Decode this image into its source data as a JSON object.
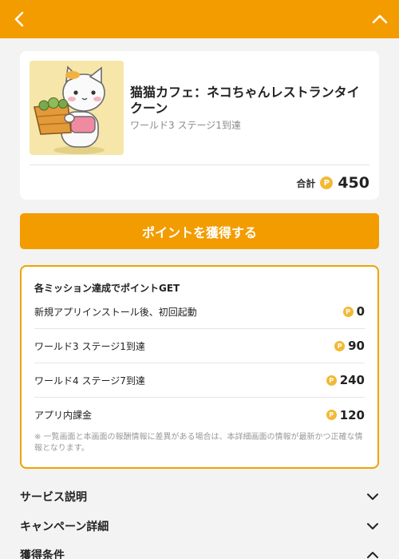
{
  "header": {
    "back_icon": "chevron-left-icon",
    "collapse_icon": "chevron-up-icon",
    "bg_color": "#f39c00"
  },
  "app": {
    "thumbnail_icon": "cat-holding-basket-illustration",
    "title": "猫猫カフェ：ネコちゃんレストランタイクーン",
    "subtitle": "ワールド3 ステージ1到達",
    "total_label": "合計",
    "coin_symbol": "P",
    "total_points": "450"
  },
  "cta": {
    "label": "ポイントを獲得する"
  },
  "missions": {
    "title": "各ミッション達成でポイントGET",
    "items": [
      {
        "label": "新規アプリインストール後、初回起動",
        "points": "0"
      },
      {
        "label": "ワールド3 ステージ1到達",
        "points": "90"
      },
      {
        "label": "ワールド4 ステージ7到達",
        "points": "240"
      },
      {
        "label": "アプリ内課金",
        "points": "120"
      }
    ],
    "note": "※ 一覧画面と本画面の報酬情報に差異がある場合は、本詳細画面の情報が最新かつ正確な情報となります。"
  },
  "accordions": [
    {
      "label": "サービス説明",
      "icon": "chevron-down-icon"
    },
    {
      "label": "キャンペーン詳細",
      "icon": "chevron-down-icon"
    },
    {
      "label": "獲得条件",
      "icon": "chevron-up-icon"
    }
  ],
  "colors": {
    "accent": "#f39c00",
    "coin": "#f2b935",
    "border": "#f0a200",
    "background": "#f3f3f3"
  }
}
